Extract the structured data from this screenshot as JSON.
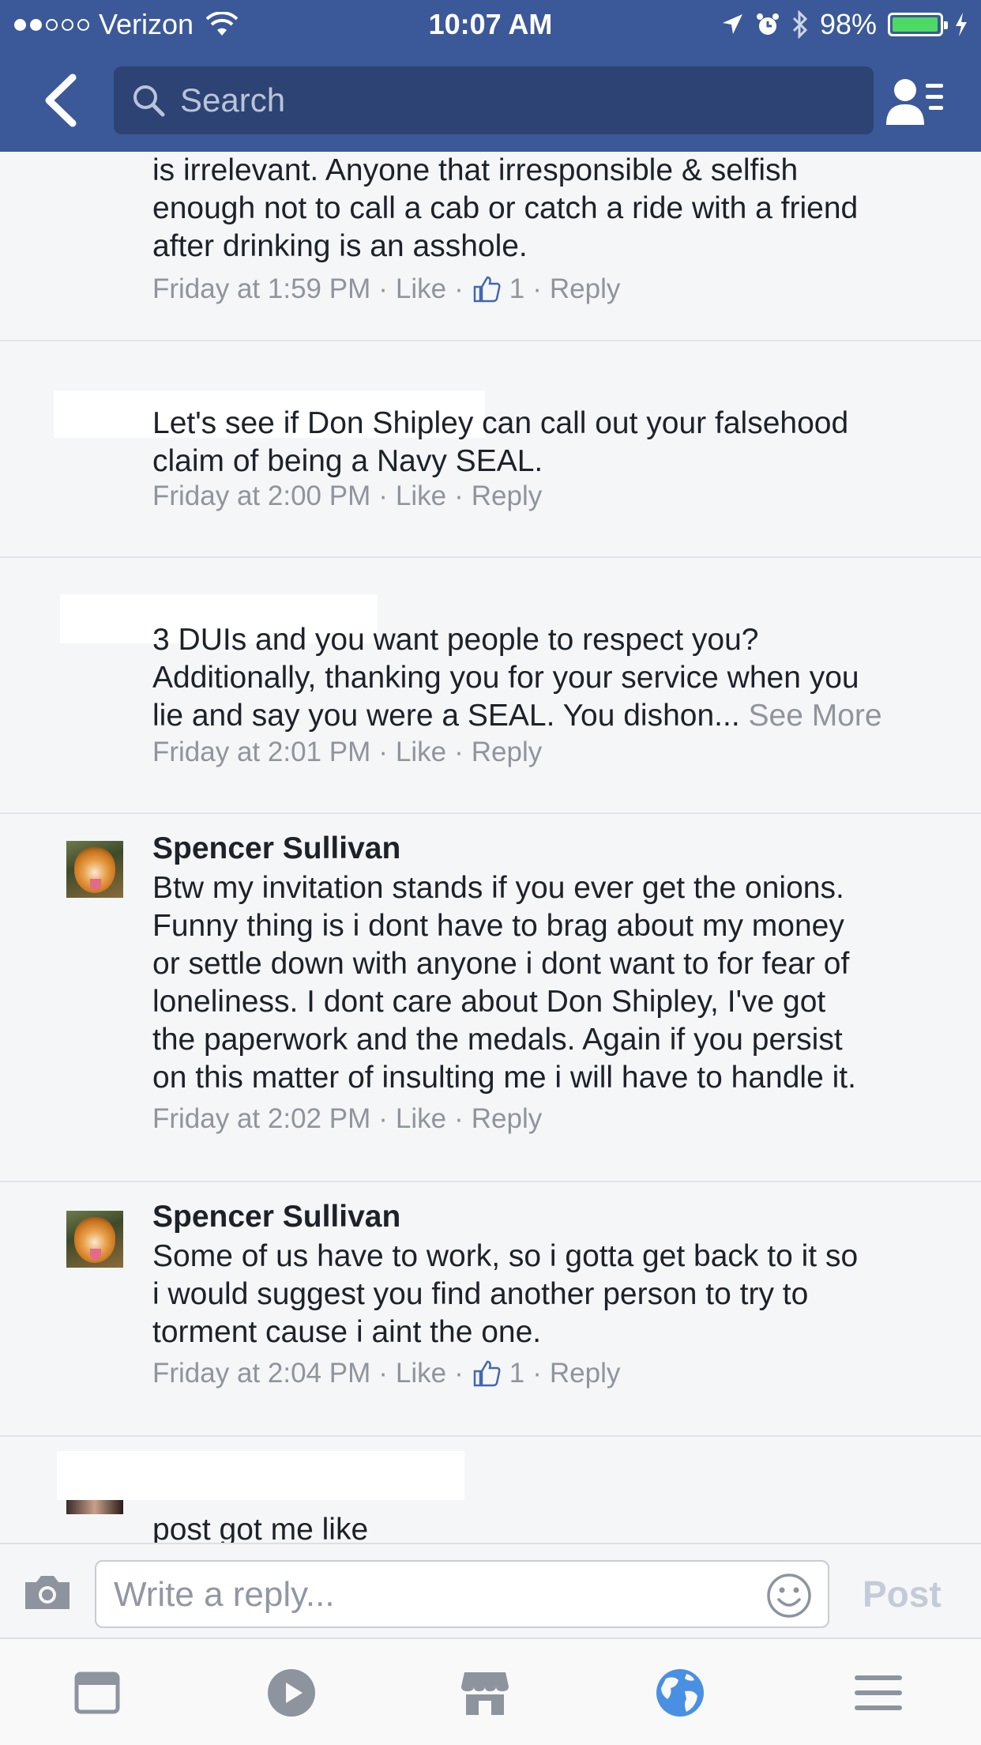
{
  "status_bar": {
    "carrier": "Verizon",
    "time": "10:07 AM",
    "battery": "98%"
  },
  "nav": {
    "search_placeholder": "Search"
  },
  "comments": [
    {
      "author": "",
      "body": "is irrelevant. Anyone that irresponsible & selfish\nenough not to call a cab or catch a ride with a friend\nafter drinking is an asshole.",
      "time": "Friday at 1:59 PM",
      "like_label": "Like",
      "like_count": "1",
      "reply_label": "Reply"
    },
    {
      "author": "",
      "body": "Let's see if Don Shipley can call out your falsehood\nclaim of being a Navy SEAL.",
      "time": "Friday at 2:00 PM",
      "like_label": "Like",
      "reply_label": "Reply"
    },
    {
      "author": "",
      "body": "3 DUIs and you want people to respect you?\nAdditionally, thanking you for your service when you\nlie and say you were a SEAL. You dishon...",
      "see_more": "See More",
      "time": "Friday at 2:01 PM",
      "like_label": "Like",
      "reply_label": "Reply"
    },
    {
      "author": "Spencer Sullivan",
      "body": "Btw my invitation stands if you ever get the onions.\nFunny thing is i dont have to brag about my money\nor settle down with anyone i dont want to for fear of\nloneliness. I dont care about Don Shipley, I've got\nthe paperwork and the medals. Again if you persist\non this matter of insulting me i will have to handle it.",
      "time": "Friday at 2:02 PM",
      "like_label": "Like",
      "reply_label": "Reply"
    },
    {
      "author": "Spencer Sullivan",
      "body": "Some of us have to work, so i gotta get back to it so\ni would suggest you find another person to try to\ntorment cause i aint the one.",
      "time": "Friday at 2:04 PM",
      "like_label": "Like",
      "like_count": "1",
      "reply_label": "Reply"
    },
    {
      "author": "",
      "body": "post got me like"
    }
  ],
  "composer": {
    "placeholder": "Write a reply...",
    "post_label": "Post"
  },
  "tabbar": {
    "active_tab": "notifications-globe"
  },
  "colors": {
    "brand": "#3b5998",
    "meta_text": "#90949c",
    "active_tab": "#4a90e2"
  }
}
